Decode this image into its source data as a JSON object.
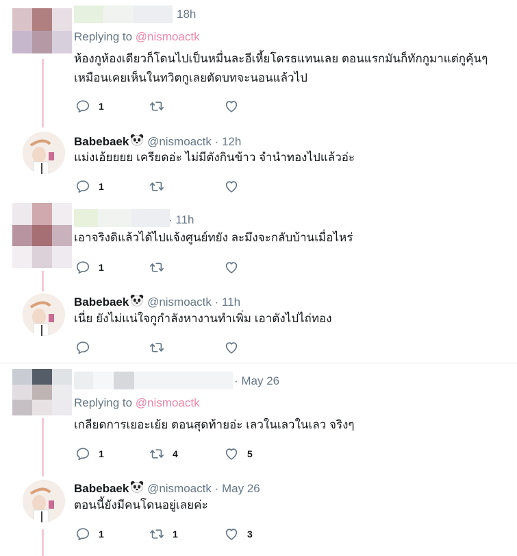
{
  "tweets": [
    {
      "time": "18h",
      "replying_prefix": "Replying to",
      "replying_handle": "@nismoactk",
      "text_lines": [
        "ห้องกูห้องเดียวก็โดนไปเป็นหมื่นละอีเหี้ยโดรธแทนเลย ตอนแรกมันก็ทักกูมาแต่กูคุ้นๆ",
        "เหมือนเคยเห็นในทวิตกูเลยตัดบทจะนอนแล้วไป"
      ],
      "reply_count": "1",
      "retweet_count": "",
      "like_count": ""
    },
    {
      "name": "Babebaek",
      "handle": "@nismoactk",
      "time": "· 12h",
      "text_lines": [
        "แม่งเอ้ยยยย เครียดอ่ะ ไม่มีตังกินข้าว จำนำทองไปแล้วอ่ะ"
      ],
      "reply_count": "1",
      "retweet_count": "",
      "like_count": ""
    },
    {
      "time": "· 11h",
      "text_lines": [
        "เอาจริงดิแล้วได้ไปแจ้งศูนย์ทยัง ละมึงจะกลับบ้านเมื่อไหร่"
      ],
      "reply_count": "1",
      "retweet_count": "",
      "like_count": ""
    },
    {
      "name": "Babebaek",
      "handle": "@nismoactk",
      "time": "· 11h",
      "text_lines": [
        "เนี่ย ยังไม่แน่ใจกูกำลังหางานทำเพิ่ม เอาตังไปไถ่ทอง"
      ],
      "reply_count": "",
      "retweet_count": "",
      "like_count": ""
    },
    {
      "time": "· May 26",
      "replying_prefix": "Replying to",
      "replying_handle": "@nismoactk",
      "text_lines": [
        "เกลียดการเยอะเย้ย ตอนสุดท้ายอ่ะ เลวในเลวในเลว จริงๆ"
      ],
      "reply_count": "1",
      "retweet_count": "4",
      "like_count": "5"
    },
    {
      "name": "Babebaek",
      "handle": "@nismoactk",
      "time": "· May 26",
      "text_lines": [
        "ตอนนี้ยังมีคนโดนอยู่เลยค่ะ"
      ],
      "reply_count": "1",
      "retweet_count": "1",
      "like_count": "3"
    }
  ],
  "icons": {
    "reply": "reply-icon",
    "retweet": "retweet-icon",
    "like": "like-icon",
    "emoji": "panda-emoji-icon"
  },
  "colors": {
    "thread_line": "#f6c9d6",
    "secondary_text": "#657786",
    "mention": "#e0245e",
    "divider": "#e6ecf0"
  }
}
